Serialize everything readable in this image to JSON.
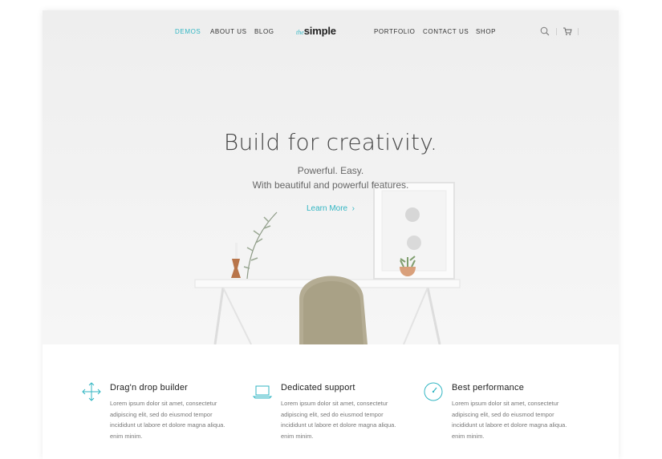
{
  "nav": {
    "left_items": [
      "DEMOS",
      "ABOUT US",
      "BLOG"
    ],
    "right_items": [
      "PORTFOLIO",
      "CONTACT US",
      "SHOP"
    ],
    "logo_the": "the",
    "logo_simple": "simple",
    "accent_color": "#33b6c3"
  },
  "hero": {
    "title": "Build for creativity.",
    "subtitle_line1": "Powerful. Easy.",
    "subtitle_line2": "With beautiful and powerful features.",
    "cta": "Learn More",
    "cta_arrow": "›"
  },
  "features": [
    {
      "icon": "move-arrows-icon",
      "title": "Drag'n drop builder",
      "lines": [
        "Lorem ipsum dolor sit amet, consectetur",
        "adipiscing elit, sed do eiusmod tempor",
        "incididunt ut labore et dolore magna aliqua.",
        "enim minim."
      ]
    },
    {
      "icon": "laptop-icon",
      "title": "Dedicated support",
      "lines": [
        "Lorem ipsum dolor sit amet, consectetur",
        "adipiscing elit, sed do eiusmod tempor",
        "incididunt ut labore et dolore magna aliqua.",
        "enim minim."
      ]
    },
    {
      "icon": "speedometer-icon",
      "title": "Best performance",
      "lines": [
        "Lorem ipsum dolor sit amet, consectetur",
        "adipiscing elit, sed do eiusmod tempor",
        "incididunt ut labore et dolore magna aliqua.",
        "enim minim."
      ]
    }
  ]
}
